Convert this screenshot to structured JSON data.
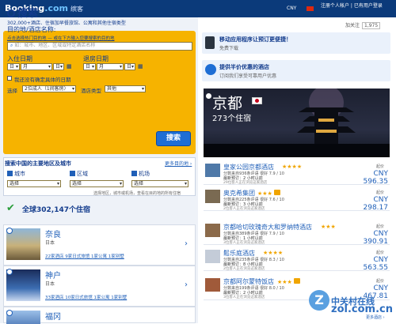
{
  "header": {
    "logo_main": "Booking",
    "logo_dotcom": ".com",
    "logo_sub": "缤客",
    "currency": "CNY",
    "links": "注册个人帐户 | 已有用户登录"
  },
  "social": {
    "like": "加关注",
    "count": "1,975"
  },
  "search": {
    "title": "搜索",
    "desc": "302,000+酒店、住宿加早餐旅馆、公寓和其他住宿类型",
    "dest_label": "目的地/酒店名称:",
    "dest_hint": "点击选择热门目的地 — 或在下方输入您要搜索的目的地",
    "dest_placeholder": "如：城市、地区、区域或特定酒店名称",
    "checkin_label": "入住日期",
    "checkout_label": "退房日期",
    "day_value": "日",
    "month_value": "月",
    "no_dates_label": "我还没有确定具体的日期",
    "rooms_label": "选择",
    "rooms_value": "2位成人（1间客房）",
    "type_label": "酒店类型",
    "type_value": "其他",
    "button": "搜索"
  },
  "regions": {
    "title": "搜索中国的主要地区及城市",
    "link": "更多目的地 ›",
    "cats": [
      {
        "label": "城市",
        "value": "选择"
      },
      {
        "label": "区域",
        "value": "选择"
      },
      {
        "label": "机场",
        "value": "选择"
      }
    ],
    "footer": "选择地区，城市或机场，查看在目的地的所有住宿"
  },
  "total": "全球302,147个住宿",
  "cities": [
    {
      "name": "奈良",
      "country": "日本",
      "stats": "22家酒店  9家日式旅馆  1家公寓  1家别墅"
    },
    {
      "name": "神户",
      "country": "日本",
      "stats": "33家酒店  10家日式旅馆  1家公寓  1家别墅"
    },
    {
      "name": "福冈",
      "country": "日本",
      "stats": ""
    }
  ],
  "promos": [
    {
      "title": "移动应用程序让预订更便捷！",
      "sub": "免费下载"
    },
    {
      "title": "提供半价优惠的酒店",
      "sub": "订阅我们享受可靠用户优惠"
    }
  ],
  "hero": {
    "name": "京都",
    "count": "273个住宿"
  },
  "hotels": [
    {
      "name": "皇家公园京都酒店",
      "stars": "★★★★",
      "score": "分数来自936条评语  很好 7.9 / 10",
      "booked": "最新预订：2 小时以前",
      "views": "29位客人正在浏览这家酒店",
      "from": "起价",
      "price": "CNY 596.35"
    },
    {
      "name": "奥克希集团",
      "stars": "★★★",
      "score": "分数来自225条评语  很好 7.6 / 10",
      "booked": "最新预订：3 小时以前",
      "views": "2位客人正在浏览这家酒店",
      "from": "起价",
      "price": "CNY 298.17"
    },
    {
      "name": "京都哈切玫瑰奇大和罗纳特酒店",
      "stars": "★★★",
      "score": "分数来自389条评语  很好 7.9 / 10",
      "booked": "最新预订：1 小时以前",
      "views": "3位客人正在浏览这家酒店",
      "from": "起价",
      "price": "CNY 390.91"
    },
    {
      "name": "鬆乐庭酒店",
      "stars": "★★★★",
      "score": "分数来自235条评语  很好 8.3 / 10",
      "booked": "最新预订：8 小时以前",
      "views": "2位客人正在浏览这家酒店",
      "from": "起价",
      "price": "CNY 563.55"
    },
    {
      "name": "京都阿尔蒙特饭店",
      "stars": "★★★",
      "score": "分数来自199条评语  很好 8.0 / 10",
      "booked": "最新预订：2 小时以前",
      "views": "3位客人正在浏览这家酒店",
      "from": "起价",
      "price": "CNY 467.81"
    }
  ],
  "watermark": {
    "line1": "中关村在线",
    "line2": "zol.com.cn",
    "more": "更多酒店 ›"
  }
}
